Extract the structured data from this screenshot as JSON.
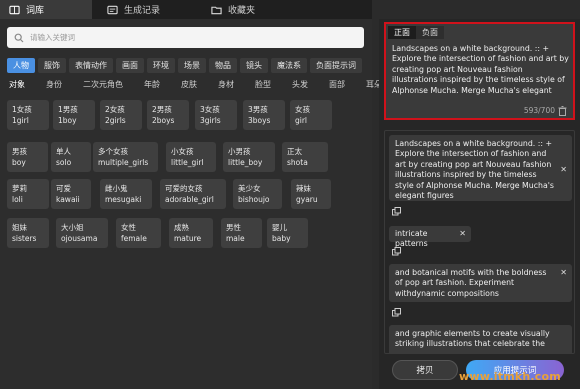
{
  "tabs": [
    {
      "label": "词库",
      "icon": "book-icon"
    },
    {
      "label": "生成记录",
      "icon": "record-icon"
    },
    {
      "label": "收藏夹",
      "icon": "folder-icon"
    }
  ],
  "search": {
    "placeholder": "请输入关键词"
  },
  "categories": [
    "人物",
    "服饰",
    "表情动作",
    "画面",
    "环境",
    "场景",
    "物品",
    "镜头",
    "魔法系",
    "负面提示词"
  ],
  "subcategories": [
    "对象",
    "身份",
    "二次元角色",
    "年龄",
    "皮肤",
    "身材",
    "脸型",
    "头发",
    "面部",
    "耳朵"
  ],
  "chips": [
    {
      "zh": "1女孩",
      "en": "1girl"
    },
    {
      "zh": "1男孩",
      "en": "1boy"
    },
    {
      "zh": "2女孩",
      "en": "2girls"
    },
    {
      "zh": "2男孩",
      "en": "2boys"
    },
    {
      "zh": "3女孩",
      "en": "3girls"
    },
    {
      "zh": "3男孩",
      "en": "3boys"
    },
    {
      "zh": "女孩",
      "en": "girl"
    },
    {
      "zh": "男孩",
      "en": "boy"
    },
    {
      "zh": "单人",
      "en": "solo"
    },
    {
      "zh": "多个女孩",
      "en": "multiple_girls"
    },
    {
      "zh": "小女孩",
      "en": "little_girl"
    },
    {
      "zh": "小男孩",
      "en": "little_boy"
    },
    {
      "zh": "正太",
      "en": "shota"
    },
    {
      "zh": "萝莉",
      "en": "loli"
    },
    {
      "zh": "可爱",
      "en": "kawaii"
    },
    {
      "zh": "雌小鬼",
      "en": "mesugaki"
    },
    {
      "zh": "可爱的女孩",
      "en": "adorable_girl"
    },
    {
      "zh": "美少女",
      "en": "bishoujo"
    },
    {
      "zh": "辣妹",
      "en": "gyaru"
    },
    {
      "zh": "姐妹",
      "en": "sisters"
    },
    {
      "zh": "大小姐",
      "en": "ojousama"
    },
    {
      "zh": "女性",
      "en": "female"
    },
    {
      "zh": "成熟",
      "en": "mature"
    },
    {
      "zh": "男性",
      "en": "male"
    },
    {
      "zh": "婴儿",
      "en": "baby"
    }
  ],
  "editor": {
    "tab_positive": "正面",
    "tab_negative": "负面",
    "text": "Landscapes on a white background. :: + Explore the intersection of fashion and art by creating pop art Nouveau fashion illustrations inspired by the timeless style of Alphonse Mucha. Merge Mucha's elegant",
    "count": "593/700"
  },
  "prompt_items": [
    {
      "text": "Landscapes on a white background. :: + Explore the intersection of fashion and art by creating pop art Nouveau fashion illustrations inspired by the timeless style of Alphonse Mucha. Merge Mucha's elegant figures"
    },
    {
      "text": "intricate patterns"
    },
    {
      "text": "and botanical motifs with the boldness of pop art fashion. Experiment withdynamic compositions"
    },
    {
      "text": "and graphic elements to create visually striking illustrations that celebrate the"
    }
  ],
  "buttons": {
    "copy": "拷贝",
    "apply": "应用提示词"
  },
  "watermark": "www.itmkh.com"
}
